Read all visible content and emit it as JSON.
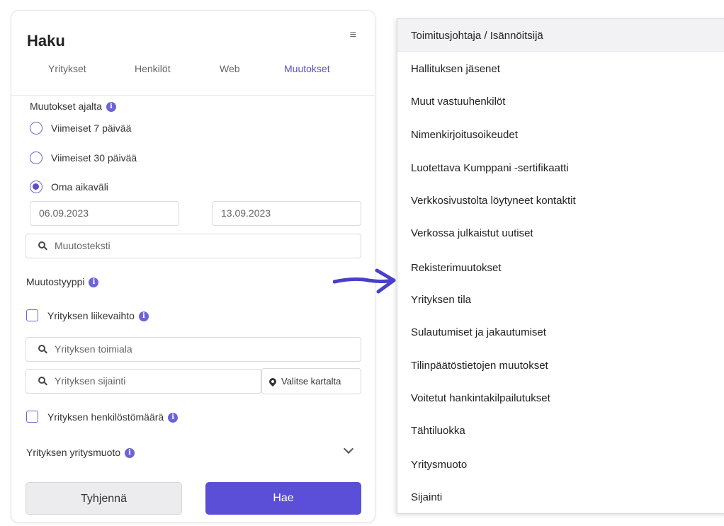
{
  "panel": {
    "title": "Haku",
    "tabs": [
      "Yritykset",
      "Henkilöt",
      "Web",
      "Muutokset"
    ],
    "active_tab": "Muutokset"
  },
  "changes_period": {
    "label": "Muutokset ajalta",
    "options": [
      "Viimeiset 7 päivää",
      "Viimeiset 30 päivää",
      "Oma aikaväli"
    ],
    "selected": "Oma aikaväli",
    "start_date": "06.09.2023",
    "end_date": "13.09.2023"
  },
  "change_text": {
    "placeholder": "Muutosteksti"
  },
  "change_type": {
    "label": "Muutostyyppi"
  },
  "revenue": {
    "label": "Yrityksen liikevaihto"
  },
  "industry": {
    "placeholder": "Yrityksen toimiala"
  },
  "location": {
    "placeholder": "Yrityksen sijainti",
    "map_button": "Valitse kartalta"
  },
  "staff": {
    "label": "Yrityksen henkilöstömäärä"
  },
  "company_form": {
    "label": "Yrityksen yritysmuoto"
  },
  "buttons": {
    "clear": "Tyhjennä",
    "search": "Hae"
  },
  "dropdown_list": [
    "Toimitusjohtaja / Isännöitsijä",
    "Hallituksen jäsenet",
    "Muut vastuuhenkilöt",
    "Nimenkirjoitusoikeudet",
    "Luotettava Kumppani -sertifikaatti",
    "Verkkosivustolta löytyneet kontaktit",
    "Verkossa julkaistut uutiset",
    "Rekisterimuutokset",
    "Yrityksen tila",
    "Sulautumiset ja jakautumiset",
    "Tilinpäätöstietojen muutokset",
    "Voitetut hankintakilpailutukset",
    "Tähtiluokka",
    "Yritysmuoto",
    "Sijainti"
  ],
  "colors": {
    "accent": "#5b4fd7",
    "arrow": "#4a3fc9"
  }
}
